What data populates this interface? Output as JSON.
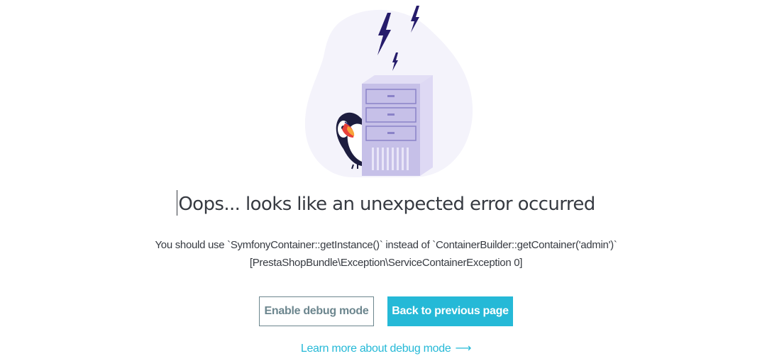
{
  "error_page": {
    "title": "Oops... looks like an unexpected error occurred",
    "message_line1": "You should use `SymfonyContainer::getInstance()` instead of `ContainerBuilder::getContainer('admin')`",
    "message_line2": "[PrestaShopBundle\\Exception\\ServiceContainerException 0]",
    "enable_debug_label": "Enable debug mode",
    "back_label": "Back to previous page",
    "learn_more_label": "Learn more about debug mode",
    "learn_more_icon": "arrow-right-icon"
  },
  "illustration": {
    "name": "server-error-illustration",
    "elements": [
      "lightning-bolt-icon",
      "server-tower",
      "puffin-mascot"
    ]
  },
  "colors": {
    "primary": "#25b9d7",
    "outline": "#6c868e",
    "text": "#363a41",
    "blob": "#f4f3fb",
    "server": "#c6c0e8",
    "bolt": "#261c6b"
  }
}
